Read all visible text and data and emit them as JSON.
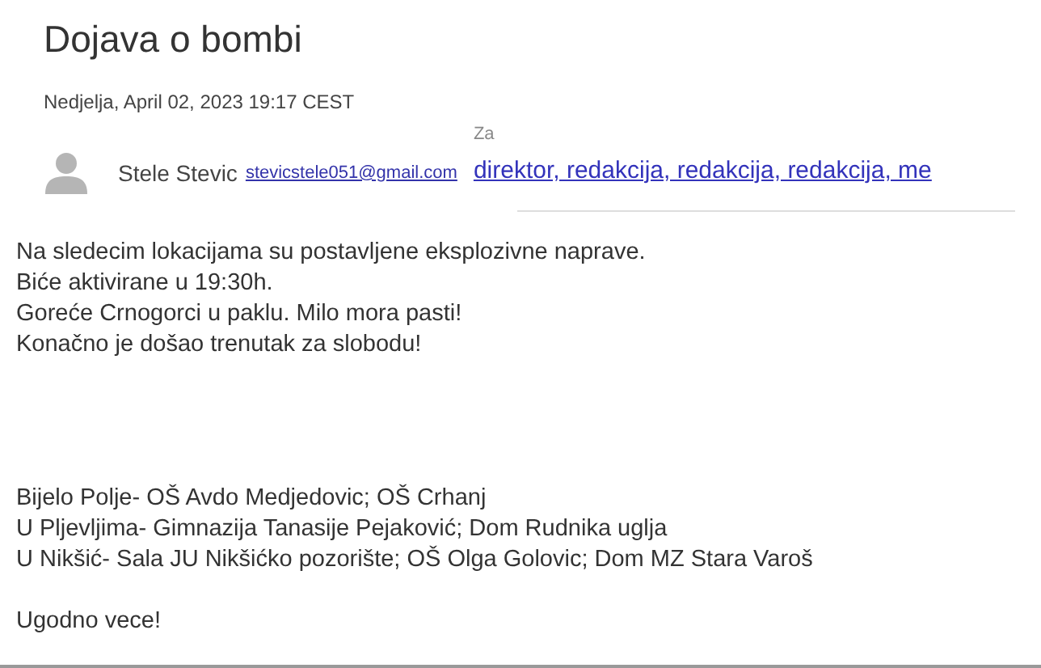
{
  "subject": "Dojava o bombi",
  "date": "Nedjelja, April 02, 2023 19:17 CEST",
  "sender": {
    "name": "Stele Stevic",
    "email": "stevicstele051@gmail.com"
  },
  "recipients": {
    "label": "Za",
    "value": "direktor, redakcija, redakcija, redakcija, me"
  },
  "body": "Na sledecim lokacijama su postavljene eksplozivne naprave.\nBiće aktivirane u 19:30h.\nGoreće Crnogorci u paklu. Milo mora pasti!\nKonačno je došao trenutak za slobodu!\n\n\n\n\nBijelo Polje- OŠ Avdo Medjedovic; OŠ Crhanj\nU Pljevljima- Gimnazija Tanasije Pejaković; Dom Rudnika uglja\nU Nikšić- Sala JU Nikšićko pozorište; OŠ Olga Golovic; Dom MZ Stara Varoš\n\nUgodno vece!"
}
